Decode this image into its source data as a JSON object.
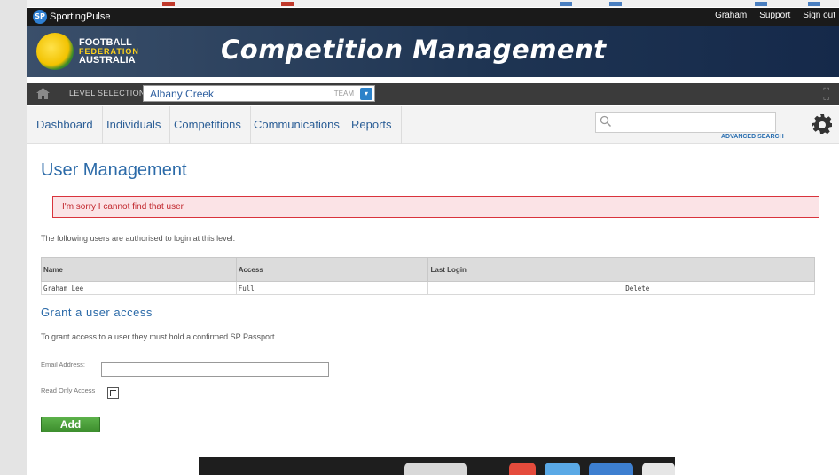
{
  "topbar": {
    "brand": "SportingPulse",
    "links": [
      "Graham",
      "Support",
      "Sign out"
    ]
  },
  "header": {
    "org_line1": "FOOTBALL",
    "org_line2": "FEDERATION",
    "org_line3": "AUSTRALIA",
    "title": "Competition Management"
  },
  "level_bar": {
    "label": "LEVEL SELECTION",
    "selected": "Albany Creek",
    "level_type": "TEAM"
  },
  "nav": {
    "items": [
      "Dashboard",
      "Individuals",
      "Competitions",
      "Communications",
      "Reports"
    ],
    "search_placeholder": "",
    "advanced_search": "ADVANCED SEARCH"
  },
  "main": {
    "title": "User Management",
    "error": "I'm sorry I cannot find that user",
    "intro": "The following users are authorised to login at this level.",
    "table": {
      "headers": [
        "Name",
        "Access",
        "Last Login",
        ""
      ],
      "rows": [
        [
          "Graham Lee",
          "Full",
          "",
          "Delete"
        ]
      ]
    },
    "grant_title": "Grant a user access",
    "grant_text": "To grant access to a user they must hold a confirmed SP Passport.",
    "email_label": "Email Address:",
    "email_value": "",
    "readonly_label": "Read Only Access",
    "add_label": "Add"
  },
  "colors": {
    "accent_blue": "#2b6aa8",
    "error_red": "#c1272d",
    "add_green": "#4ca03b"
  }
}
